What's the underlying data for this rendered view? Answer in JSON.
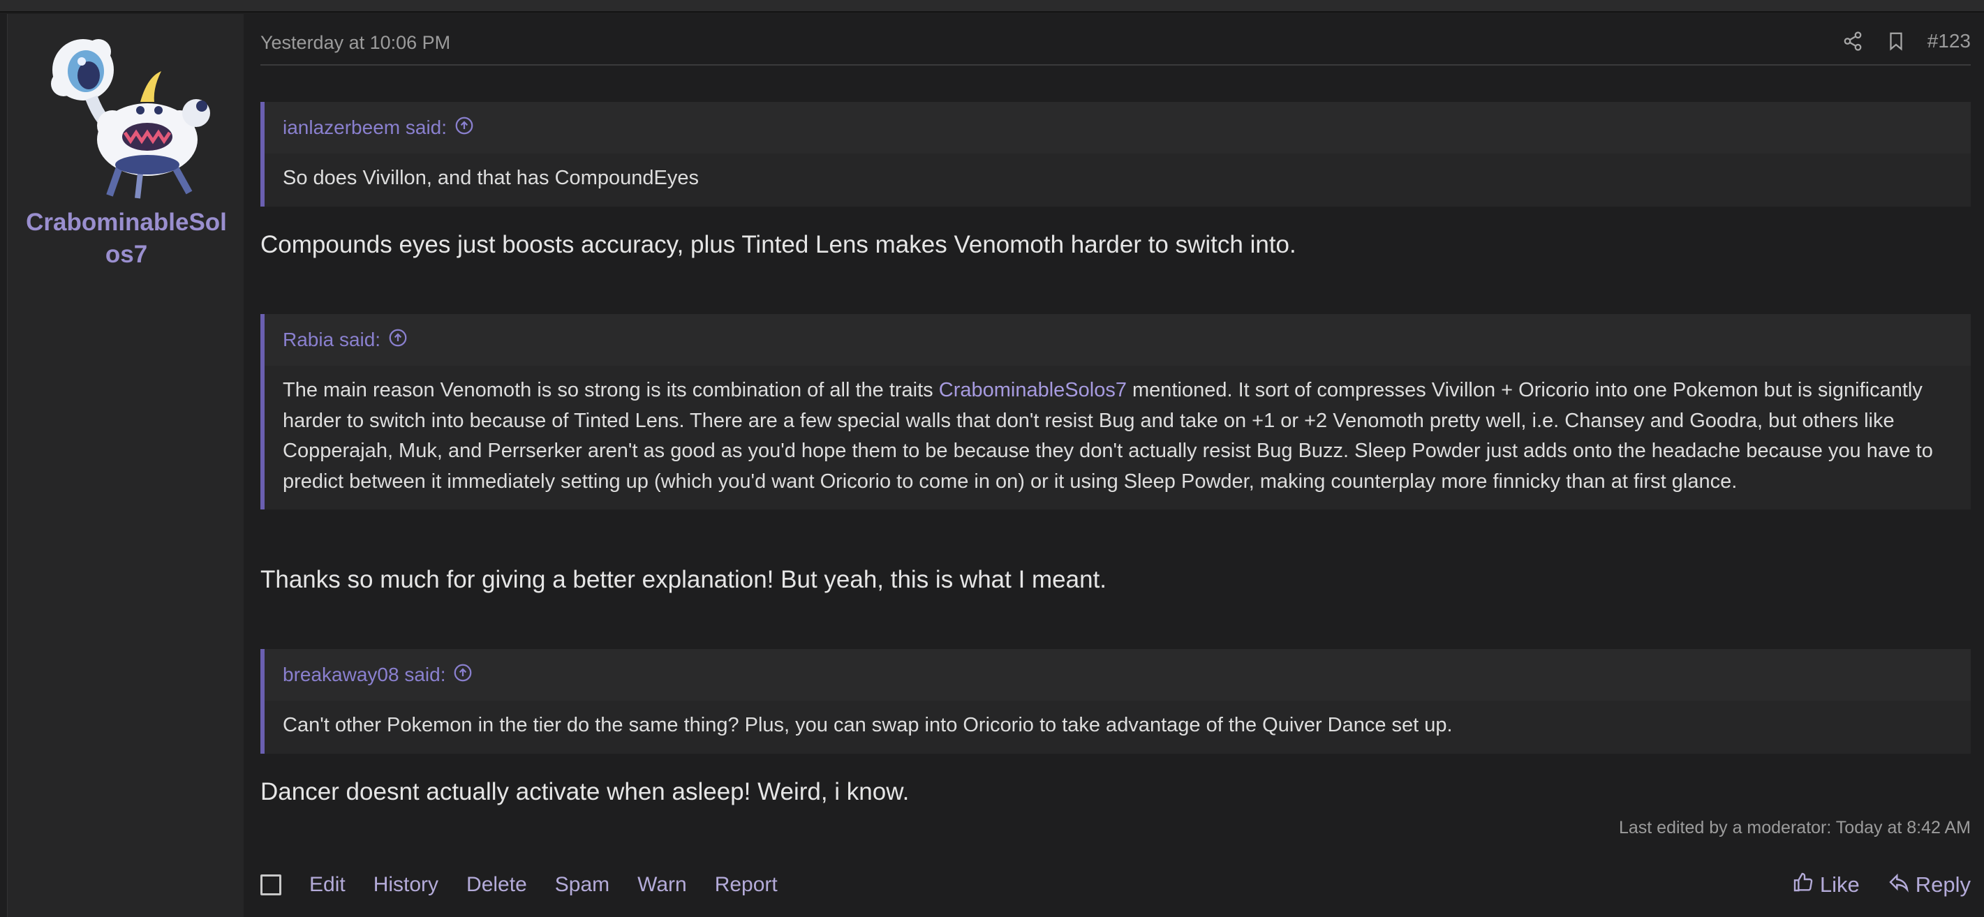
{
  "post": {
    "author": "CrabominableSolos7",
    "date": "Yesterday at 10:06 PM",
    "number": "#123",
    "quotes": [
      {
        "author_line": "ianlazerbeem said:",
        "text": "So does Vivillon, and that has CompoundEyes"
      },
      {
        "author_line": "Rabia said:",
        "text_before": "The main reason Venomoth is so strong is its combination of all the traits ",
        "mention": "CrabominableSolos7",
        "text_after": " mentioned. It sort of compresses Vivillon + Oricorio into one Pokemon but is significantly harder to switch into because of Tinted Lens. There are a few special walls that don't resist Bug and take on +1 or +2 Venomoth pretty well, i.e. Chansey and Goodra, but others like Copperajah, Muk, and Perrserker aren't as good as you'd hope them to be because they don't actually resist Bug Buzz. Sleep Powder just adds onto the headache because you have to predict between it immediately setting up (which you'd want Oricorio to come in on) or it using Sleep Powder, making counterplay more finnicky than at first glance."
      },
      {
        "author_line": "breakaway08 said:",
        "text": "Can't other Pokemon in the tier do the same thing? Plus, you can swap into Oricorio to take advantage of the Quiver Dance set up."
      }
    ],
    "replies": [
      "Compounds eyes just boosts accuracy, plus Tinted Lens makes Venomoth harder to switch into.",
      "Thanks so much for giving a better explanation! But yeah, this is what I meant.",
      "Dancer doesnt actually activate when asleep! Weird, i know."
    ],
    "edited_note": "Last edited by a moderator: Today at 8:42 AM"
  },
  "footer": {
    "left_actions": [
      "Edit",
      "History",
      "Delete",
      "Spam",
      "Warn",
      "Report"
    ],
    "like": "Like",
    "reply": "Reply"
  },
  "icons": {
    "share": "share-icon",
    "bookmark": "bookmark-icon",
    "quote_jump": "arrow-up-circle-icon",
    "like": "thumbs-up-icon",
    "reply": "reply-icon"
  },
  "colors": {
    "accent": "#8a80cf",
    "quote_border": "#6a5fb0",
    "background": "#1e1e1f",
    "sidebar": "#262627"
  }
}
